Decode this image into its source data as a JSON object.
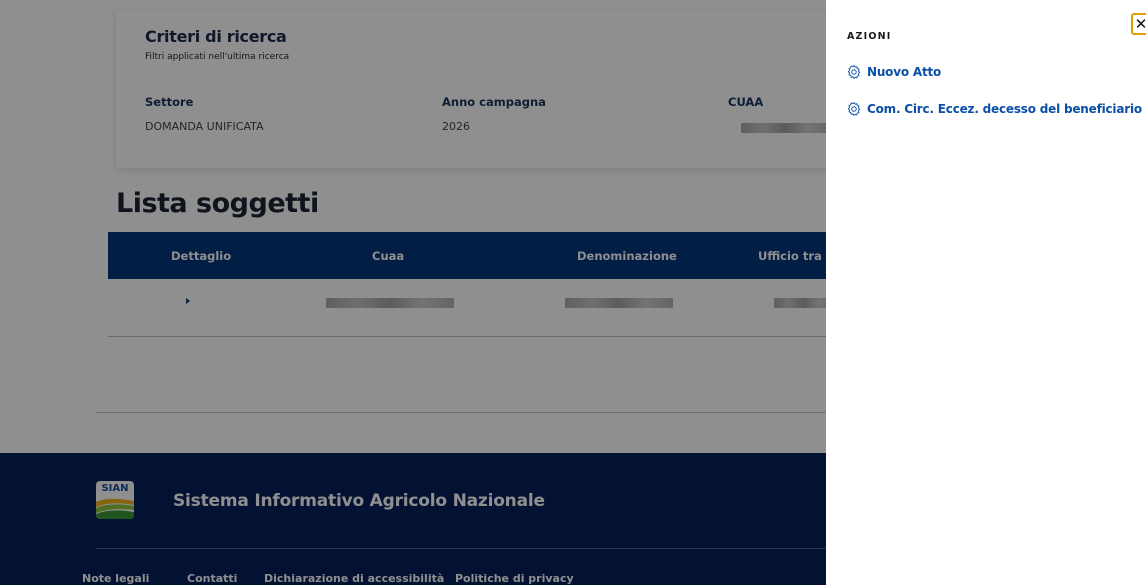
{
  "search_criteria": {
    "title": "Criteri di ricerca",
    "subtitle": "Filtri applicati nell'ultima ricerca",
    "fields": [
      {
        "label": "Settore",
        "value": "DOMANDA UNIFICATA"
      },
      {
        "label": "Anno campagna",
        "value": "2026"
      },
      {
        "label": "CUAA",
        "value": ""
      }
    ]
  },
  "list": {
    "title": "Lista soggetti",
    "columns": [
      "Dettaglio",
      "Cuaa",
      "Denominazione",
      "Ufficio tra"
    ]
  },
  "footer": {
    "logo_text": "SIAN",
    "title": "Sistema Informativo Agricolo Nazionale",
    "links": [
      "Note legali",
      "Contatti",
      "Dichiarazione di accessibilità",
      "Politiche di privacy"
    ]
  },
  "panel": {
    "heading": "AZIONI",
    "actions": [
      {
        "label": "Nuovo Atto",
        "icon": "gear-icon"
      },
      {
        "label": "Com. Circ. Eccez. decesso del beneficiario",
        "icon": "gear-icon"
      }
    ],
    "close_label": "✕"
  },
  "colors": {
    "header_blue": "#06377a",
    "footer_navy": "#06205c",
    "link_blue": "#0b4fa8",
    "focus_outline": "#e0a100"
  }
}
